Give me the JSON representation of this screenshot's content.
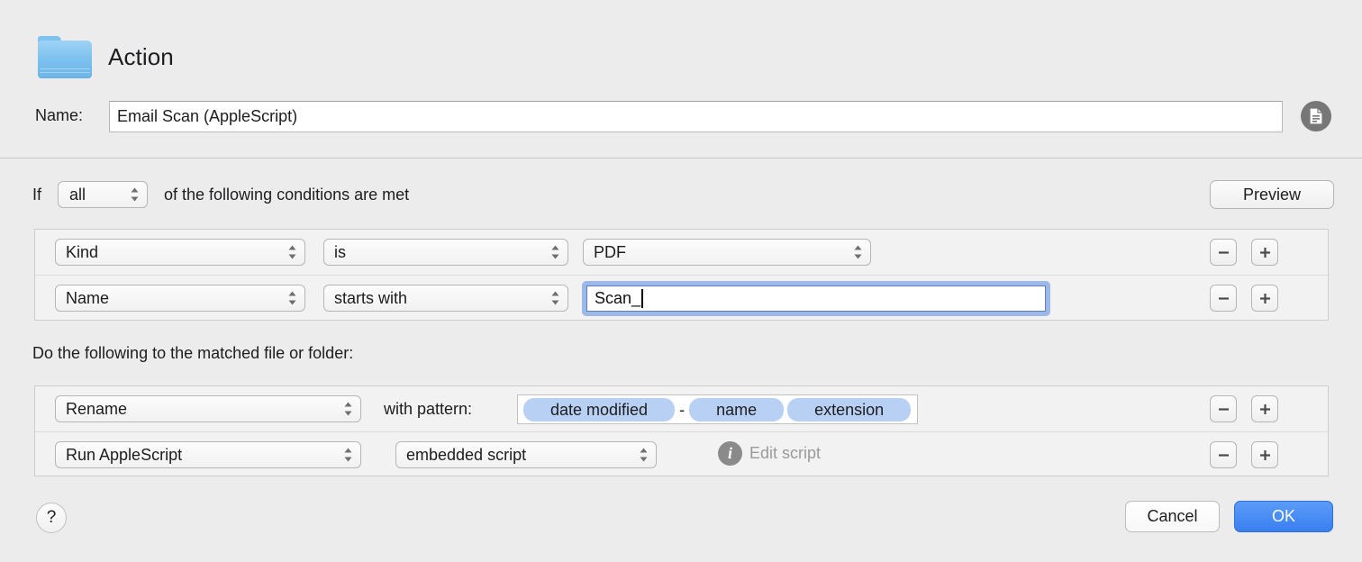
{
  "header": {
    "icon": "folder-icon",
    "title": "Action",
    "name_label": "Name:",
    "name_value": "Email Scan (AppleScript)",
    "doc_button_icon": "document-icon"
  },
  "conditions_section": {
    "if_label": "If",
    "match_mode": "all",
    "trailing_text": "of the following conditions are met",
    "preview_label": "Preview",
    "rows": [
      {
        "attribute": "Kind",
        "operator": "is",
        "value": "PDF",
        "remove_label": "−",
        "add_label": "+"
      },
      {
        "attribute": "Name",
        "operator": "starts with",
        "value": "Scan_",
        "focused": true,
        "remove_label": "−",
        "add_label": "+"
      }
    ]
  },
  "actions_section": {
    "label": "Do the following to the matched file or folder:",
    "rows": [
      {
        "action": "Rename",
        "pattern_label": "with pattern:",
        "tokens": [
          "date modified",
          "name",
          "extension"
        ],
        "token_separator": "-",
        "remove_label": "−",
        "add_label": "+"
      },
      {
        "action": "Run AppleScript",
        "script_source": "embedded script",
        "edit_script_label": "Edit script",
        "info_icon": "info-icon",
        "remove_label": "−",
        "add_label": "+"
      }
    ]
  },
  "footer": {
    "help_label": "?",
    "cancel_label": "Cancel",
    "ok_label": "OK"
  },
  "colors": {
    "accent": "#3a7ff0",
    "token": "#b9d0f5",
    "focus_ring": "#9cb8e8",
    "folder": "#7bc0ee",
    "window_bg": "#ececec"
  }
}
